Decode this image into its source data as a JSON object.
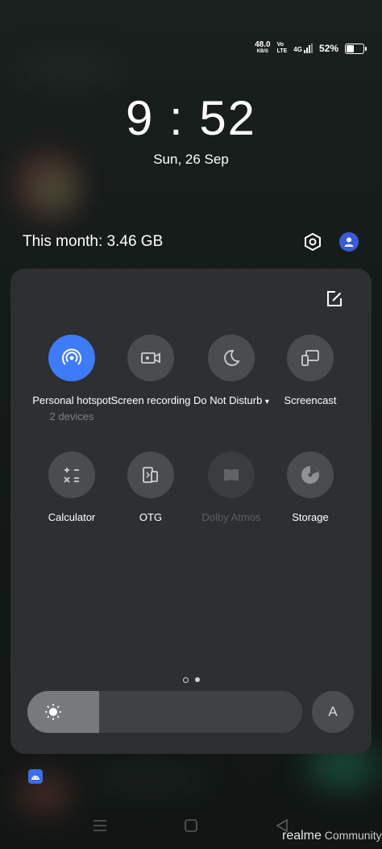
{
  "status_bar": {
    "speed_value": "48.0",
    "speed_unit": "KB/S",
    "volte_top": "Vo",
    "volte_bottom": "LTE",
    "network": "4G",
    "battery_percent": "52%",
    "battery_level": 0.52
  },
  "lockscreen": {
    "time": "9 : 52",
    "date": "Sun, 26 Sep"
  },
  "header": {
    "data_usage": "This month: 3.46 GB",
    "settings_icon": "hexagon-settings-icon",
    "avatar_icon": "user-avatar-icon"
  },
  "quick_settings": {
    "edit_icon": "edit-icon",
    "tiles": [
      {
        "label": "Personal hotspot",
        "sub": "2 devices",
        "icon": "hotspot-icon",
        "state": "active"
      },
      {
        "label": "Screen recording",
        "sub": "",
        "icon": "screen-record-icon",
        "state": "off"
      },
      {
        "label": "Do Not Disturb",
        "sub": "",
        "icon": "moon-icon",
        "state": "off",
        "dropdown": "▾"
      },
      {
        "label": "Screencast",
        "sub": "",
        "icon": "screencast-icon",
        "state": "off"
      },
      {
        "label": "Calculator",
        "sub": "",
        "icon": "calculator-icon",
        "state": "off"
      },
      {
        "label": "OTG",
        "sub": "",
        "icon": "otg-icon",
        "state": "off"
      },
      {
        "label": "Dolby Atmos",
        "sub": "",
        "icon": "dolby-icon",
        "state": "disabled"
      },
      {
        "label": "Storage",
        "sub": "",
        "icon": "storage-icon",
        "state": "off"
      }
    ],
    "page_count": 2,
    "current_page": 2,
    "brightness_level": 0.26,
    "auto_brightness_label": "A"
  },
  "navigation": {
    "menu_icon": "menu-icon",
    "home_icon": "home-icon",
    "back_icon": "back-icon"
  },
  "watermark": {
    "brand": "realme",
    "text": "Community"
  },
  "colors": {
    "accent": "#3e7bf6",
    "panel": "#2d2f31",
    "tile": "#4a4c4f"
  }
}
